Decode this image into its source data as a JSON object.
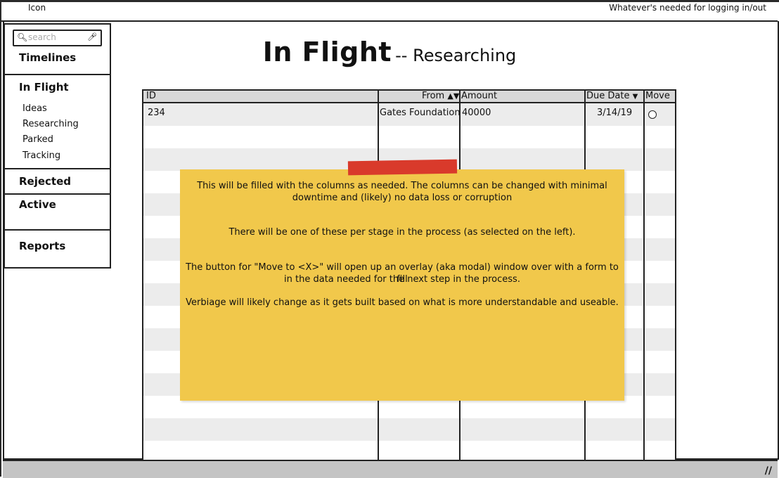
{
  "topbar": {
    "logo": "Icon",
    "login": "Whatever's needed for logging in/out"
  },
  "search": {
    "placeholder": "search"
  },
  "sidebar": {
    "timelines": "Timelines",
    "in_flight": "In Flight",
    "sub_items": [
      "Ideas",
      "Researching",
      "Parked",
      "Tracking"
    ],
    "rejected": "Rejected",
    "active": "Active",
    "reports": "Reports"
  },
  "title": {
    "main": "In Flight",
    "sub": "-- Researching"
  },
  "table": {
    "headers": {
      "id": "ID",
      "from": "From",
      "amount": "Amount",
      "due_date": "Due Date",
      "move": "Move"
    },
    "rows": [
      {
        "id": "234",
        "from": "Gates Foundation",
        "amount": "40000",
        "due_date": "3/14/19"
      }
    ]
  },
  "note": {
    "line1": "This will be filled with the columns as needed. The columns can be changed with minimal",
    "line2": "downtime and (likely) no data loss or corruption",
    "line3": "There will be one of these per stage in the process (as selected on the left).",
    "line4": "The button for \"Move to <X>\" will open up an overlay (aka modal) window over with a form to fill",
    "line5": "in the data needed for the next step in the process.",
    "line6": "Verbiage will likely change as it gets built based on what is more understandable and useable."
  },
  "colors": {
    "note": "#f1c84b",
    "tape": "#d93a2b",
    "stripe": "#ececec",
    "header": "#d8d8d8"
  }
}
